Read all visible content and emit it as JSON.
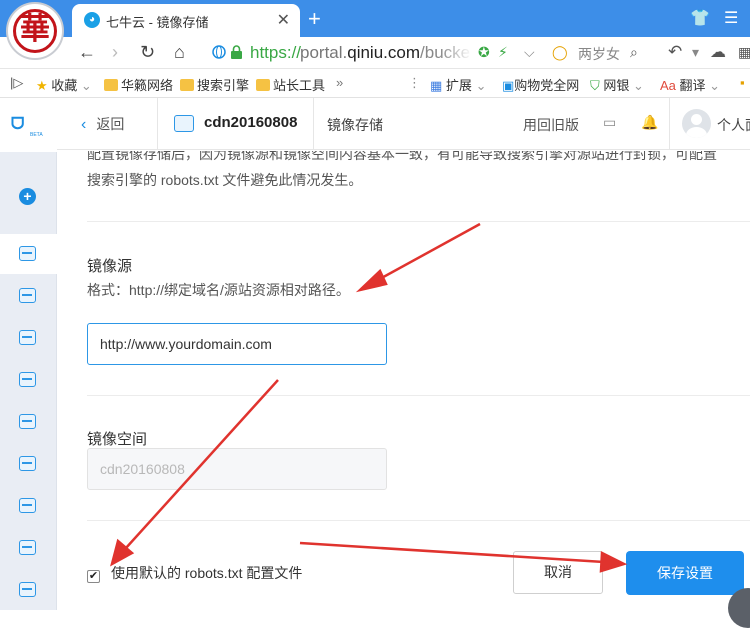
{
  "browser": {
    "tab_title": "七牛云 - 镜像存储",
    "url_scheme": "https://",
    "url_host_prefix": "portal.",
    "url_host_main": "qiniu.com",
    "url_path": "/bucke",
    "search_hint": "两岁女"
  },
  "bookmarks": {
    "items": [
      "收藏",
      "华籁网络",
      "搜索引擎",
      "站长工具"
    ],
    "more": "»",
    "right_items": [
      "扩展",
      "购物党全网",
      "网银",
      "翻译"
    ]
  },
  "header": {
    "back_label": "返回",
    "bucket_name": "cdn20160808",
    "page_tab": "镜像存储",
    "old_version": "用回旧版",
    "user_label": "个人面"
  },
  "main": {
    "desc_line1": "配置镜像存储后，因为镜像源和镜像空间内容基本一致，有可能导致搜索引擎对源站进行封锁，可配置",
    "desc_line2": "搜索引擎的 robots.txt 文件避免此情况发生。",
    "mirror_source": {
      "label": "镜像源",
      "hint": "格式：http://绑定域名/源站资源相对路径。",
      "value": "http://www.yourdomain.com"
    },
    "mirror_space": {
      "label": "镜像空间",
      "value": "cdn20160808"
    },
    "robots_checkbox_label": "使用默认的 robots.txt 配置文件",
    "robots_checked": true,
    "cancel_label": "取消",
    "save_label": "保存设置"
  },
  "colors": {
    "accent": "#1e8eed",
    "arrow": "#e0332e"
  }
}
